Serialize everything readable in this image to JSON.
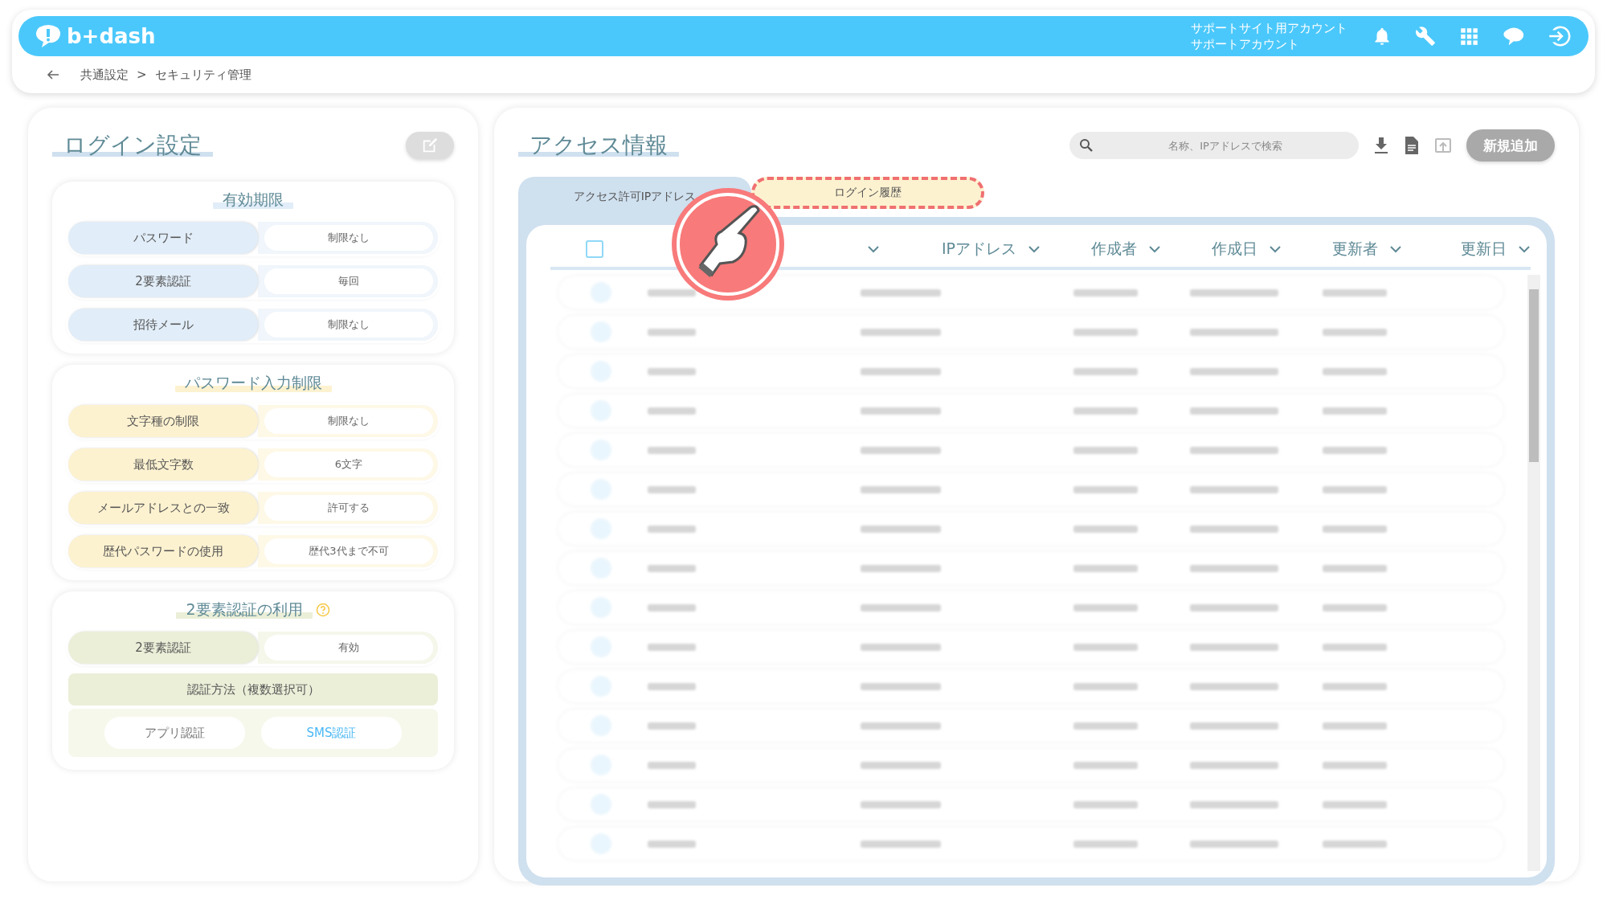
{
  "header": {
    "logo": "b+dash",
    "account_lines": [
      "サポートサイト用アカウント",
      "サポートアカウント"
    ]
  },
  "breadcrumb": {
    "items": [
      "共通設定",
      ">",
      "セキュリティ管理"
    ]
  },
  "login_settings": {
    "title": "ログイン設定",
    "sections": [
      {
        "heading": "有効期限",
        "color": "#e1edf8",
        "help": false,
        "rows": [
          {
            "label": "パスワード",
            "value": "制限なし"
          },
          {
            "label": "2要素認証",
            "value": "毎回"
          },
          {
            "label": "招待メール",
            "value": "制限なし"
          }
        ]
      },
      {
        "heading": "パスワード入力制限",
        "color": "#fdf2d0",
        "help": false,
        "rows": [
          {
            "label": "文字種の制限",
            "value": "制限なし"
          },
          {
            "label": "最低文字数",
            "value": "6文字"
          },
          {
            "label": "メールアドレスとの一致",
            "value": "許可する"
          },
          {
            "label": "歴代パスワードの使用",
            "value": "歴代3代まで不可"
          }
        ]
      },
      {
        "heading": "2要素認証の利用",
        "color": "#ebefd8",
        "help": true,
        "rows": [
          {
            "label": "2要素認証",
            "value": "有効"
          }
        ],
        "methods": {
          "title": "認証方法（複数選択可）",
          "options": [
            {
              "label": "アプリ認証",
              "selected": false
            },
            {
              "label": "SMS認証",
              "selected": true
            }
          ]
        }
      }
    ]
  },
  "access_info": {
    "title": "アクセス情報",
    "search": {
      "placeholder": "名称、IPアドレスで検索"
    },
    "add_button": {
      "label": "新規追加",
      "disabled": true
    },
    "tabs": [
      {
        "label": "アクセス許可IPアドレス",
        "selected": true,
        "highlighted": false
      },
      {
        "label": "ログイン履歴",
        "selected": false,
        "highlighted": true
      }
    ],
    "table": {
      "select_all": {
        "checked": false
      },
      "columns": [
        "",
        "IPアドレス",
        "作成者",
        "作成日",
        "更新者",
        "更新日"
      ]
    }
  }
}
